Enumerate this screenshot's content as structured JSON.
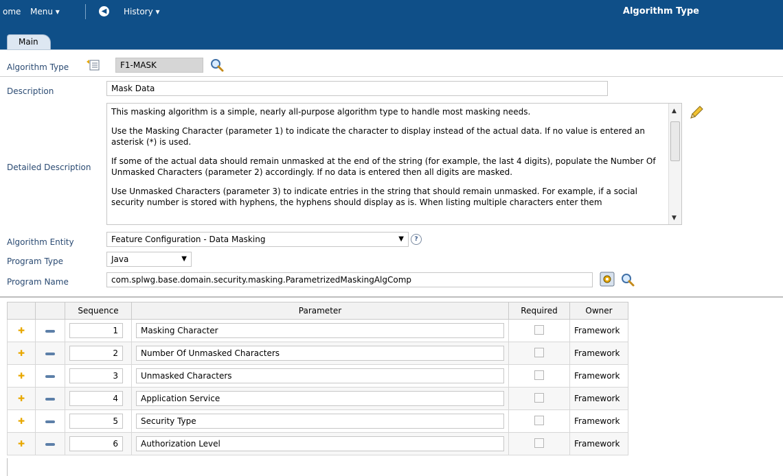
{
  "header": {
    "home_label": "ome",
    "menu_label": "Menu ▾",
    "history_label": "History ▾",
    "title": "Algorithm Type"
  },
  "tabs": [
    {
      "label": "Main"
    }
  ],
  "algorithm_type": {
    "label": "Algorithm Type",
    "value": "F1-MASK"
  },
  "form": {
    "description_label": "Description",
    "description_value": "Mask Data",
    "detailed_label": "Detailed Description",
    "detailed_paragraphs": [
      "This masking algorithm is a simple, nearly all-purpose algorithm type to handle most masking needs.",
      "Use the Masking Character (parameter 1) to indicate the character to display instead of the actual data.  If no value is entered an asterisk (*) is used.",
      "If some of the actual data should remain unmasked at the end of the string (for example, the last 4 digits), populate the Number Of Unmasked Characters (parameter 2) accordingly.  If no data is entered then all digits are masked.",
      "Use Unmasked Characters (parameter 3) to indicate entries in the string that should remain unmasked.  For example, if a social security number is stored with hyphens, the hyphens should display as is.  When listing multiple characters enter them"
    ],
    "entity_label": "Algorithm Entity",
    "entity_value": "Feature Configuration - Data Masking",
    "program_type_label": "Program Type",
    "program_type_value": "Java",
    "program_name_label": "Program Name",
    "program_name_value": "com.splwg.base.domain.security.masking.ParametrizedMaskingAlgComp"
  },
  "grid": {
    "headers": [
      "Sequence",
      "Parameter",
      "Required",
      "Owner"
    ],
    "rows": [
      {
        "seq": "1",
        "param": "Masking Character",
        "owner": "Framework"
      },
      {
        "seq": "2",
        "param": "Number Of Unmasked Characters",
        "owner": "Framework"
      },
      {
        "seq": "3",
        "param": "Unmasked Characters",
        "owner": "Framework"
      },
      {
        "seq": "4",
        "param": "Application Service",
        "owner": "Framework"
      },
      {
        "seq": "5",
        "param": "Security Type",
        "owner": "Framework"
      },
      {
        "seq": "6",
        "param": "Authorization Level",
        "owner": "Framework"
      }
    ]
  },
  "colors": {
    "header_bg": "#0f4f88",
    "label": "#2a4a72",
    "add_icon": "#e8a800"
  }
}
